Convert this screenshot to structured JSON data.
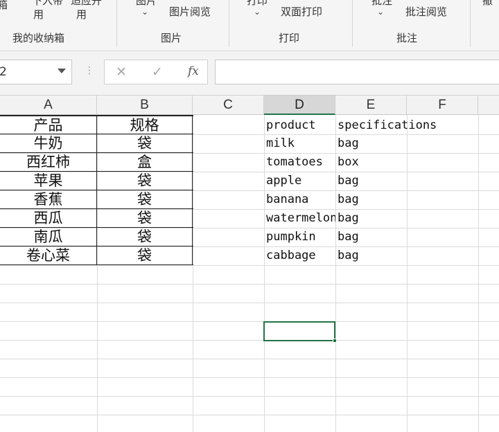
{
  "ribbon": {
    "partials": {
      "top1": "箱",
      "top2": "下入帝",
      "top3": "适应开",
      "top4": "用",
      "top5": "用",
      "top6": "图片",
      "top7": "打印",
      "top8": "批注",
      "top9": "撤"
    },
    "buttons": {
      "picture_view": "图片阅览",
      "duplex_print": "双面打印",
      "comment_view": "批注阅览"
    },
    "arrows": {
      "a1": "⌄",
      "a2": "⌄",
      "a3": "⌄"
    },
    "groups": {
      "storage": "我的收纳箱",
      "picture": "图片",
      "print": "打印",
      "comment": "批注"
    }
  },
  "formula_bar": {
    "name_box": "2",
    "dots": "⋮",
    "cancel": "✕",
    "confirm": "✓",
    "fx": "fx",
    "value": ""
  },
  "columns": [
    "A",
    "B",
    "C",
    "D",
    "E",
    "F"
  ],
  "table_cn": {
    "header": [
      "产品",
      "规格"
    ],
    "rows": [
      [
        "牛奶",
        "袋"
      ],
      [
        "西红柿",
        "盒"
      ],
      [
        "苹果",
        "袋"
      ],
      [
        "香蕉",
        "袋"
      ],
      [
        "西瓜",
        "袋"
      ],
      [
        "南瓜",
        "袋"
      ],
      [
        "卷心菜",
        "袋"
      ]
    ]
  },
  "table_en": {
    "header": [
      "product",
      "specifications"
    ],
    "rows": [
      [
        "milk",
        "bag"
      ],
      [
        "tomatoes",
        "box"
      ],
      [
        "apple",
        "bag"
      ],
      [
        "banana",
        "bag"
      ],
      [
        "watermelon",
        "bag"
      ],
      [
        "pumpkin",
        "bag"
      ],
      [
        "cabbage",
        "bag"
      ]
    ]
  },
  "colors": {
    "accent": "#217346",
    "header_bg": "#f2f2f2",
    "gridline": "#dadada"
  }
}
